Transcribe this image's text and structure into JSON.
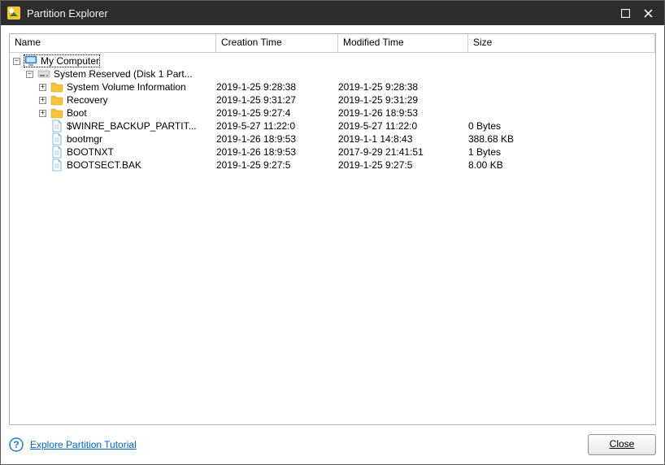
{
  "window": {
    "title": "Partition Explorer"
  },
  "columns": {
    "name": "Name",
    "ctime": "Creation Time",
    "mtime": "Modified Time",
    "size": "Size"
  },
  "tree": {
    "root": {
      "label": "My Computer",
      "children": {
        "disk": {
          "label": "System Reserved (Disk 1 Part...",
          "items": [
            {
              "type": "folder",
              "name": "System Volume Information",
              "ctime": "2019-1-25 9:28:38",
              "mtime": "2019-1-25 9:28:38",
              "size": "",
              "expandable": true
            },
            {
              "type": "folder",
              "name": "Recovery",
              "ctime": "2019-1-25 9:31:27",
              "mtime": "2019-1-25 9:31:29",
              "size": "",
              "expandable": true
            },
            {
              "type": "folder",
              "name": "Boot",
              "ctime": "2019-1-25 9:27:4",
              "mtime": "2019-1-26 18:9:53",
              "size": "",
              "expandable": true
            },
            {
              "type": "file",
              "name": "$WINRE_BACKUP_PARTIT...",
              "ctime": "2019-5-27 11:22:0",
              "mtime": "2019-5-27 11:22:0",
              "size": "0 Bytes",
              "expandable": false
            },
            {
              "type": "file",
              "name": "bootmgr",
              "ctime": "2019-1-26 18:9:53",
              "mtime": "2019-1-1 14:8:43",
              "size": "388.68 KB",
              "expandable": false
            },
            {
              "type": "file",
              "name": "BOOTNXT",
              "ctime": "2019-1-26 18:9:53",
              "mtime": "2017-9-29 21:41:51",
              "size": "1 Bytes",
              "expandable": false
            },
            {
              "type": "file",
              "name": "BOOTSECT.BAK",
              "ctime": "2019-1-25 9:27:5",
              "mtime": "2019-1-25 9:27:5",
              "size": "8.00 KB",
              "expandable": false
            }
          ]
        }
      }
    }
  },
  "footer": {
    "tutorial_link": "Explore Partition Tutorial",
    "close_label": "Close"
  }
}
